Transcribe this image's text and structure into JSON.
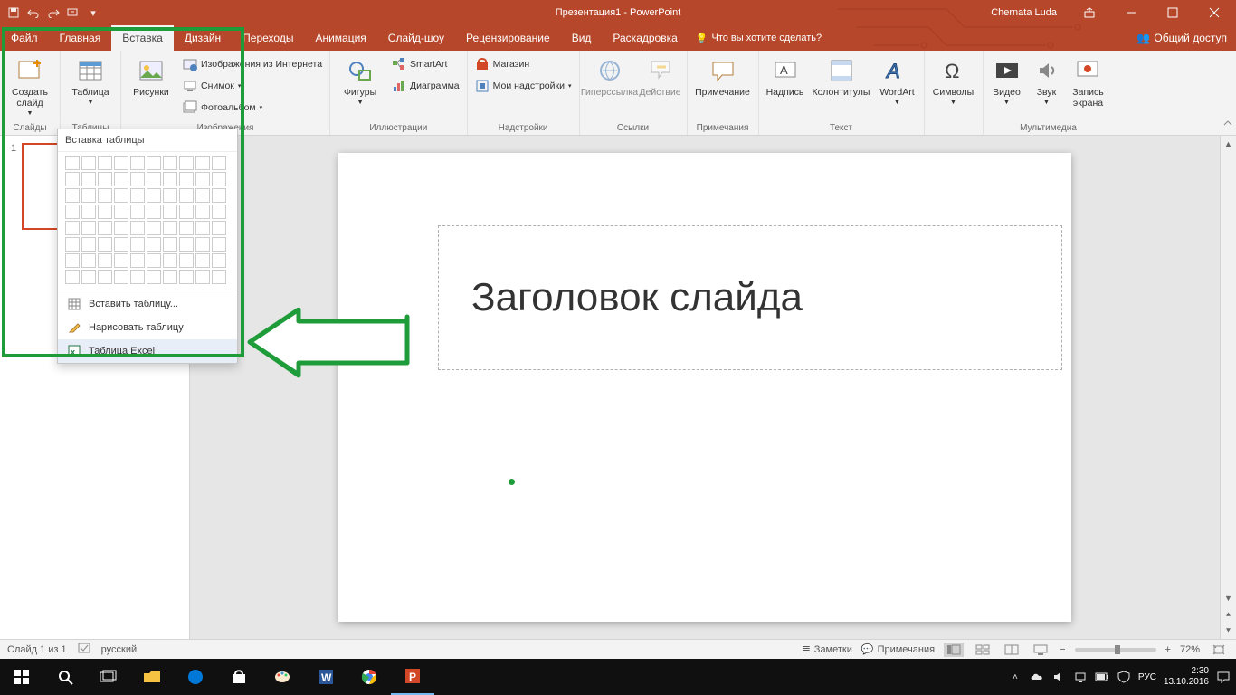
{
  "titlebar": {
    "app_title": "Презентация1 - PowerPoint",
    "user": "Chernata Luda",
    "qat_icons": [
      "save-icon",
      "undo-icon",
      "redo-icon",
      "start-from-beginning-icon"
    ]
  },
  "tabs": {
    "items": [
      "Файл",
      "Главная",
      "Вставка",
      "Дизайн",
      "Переходы",
      "Анимация",
      "Слайд-шоу",
      "Рецензирование",
      "Вид",
      "Раскадровка"
    ],
    "active": "Вставка",
    "tell_me": "Что вы хотите сделать?",
    "share": "Общий доступ"
  },
  "ribbon": {
    "slides": {
      "new_slide": "Создать слайд",
      "group": "Слайды"
    },
    "tables": {
      "table": "Таблица",
      "group": "Таблицы"
    },
    "images": {
      "pictures": "Рисунки",
      "online_pictures": "Изображения из Интернета",
      "screenshot": "Снимок",
      "photo_album": "Фотоальбом",
      "group": "Изображения"
    },
    "illustrations": {
      "shapes": "Фигуры",
      "smartart": "SmartArt",
      "chart": "Диаграмма",
      "group": "Иллюстрации"
    },
    "addins": {
      "store": "Магазин",
      "my_addins": "Мои надстройки",
      "group": "Надстройки"
    },
    "links": {
      "hyperlink": "Гиперссылка",
      "action": "Действие",
      "group": "Ссылки"
    },
    "comments": {
      "comment": "Примечание",
      "group": "Примечания"
    },
    "text": {
      "text_box": "Надпись",
      "header_footer": "Колонтитулы",
      "wordart": "WordArt",
      "group": "Текст"
    },
    "symbols": {
      "symbols": "Символы"
    },
    "media": {
      "video": "Видео",
      "audio": "Звук",
      "screen_rec": "Запись экрана",
      "group": "Мультимедиа"
    }
  },
  "table_dropdown": {
    "title": "Вставка таблицы",
    "insert_table": "Вставить таблицу...",
    "draw_table": "Нарисовать таблицу",
    "excel_table": "Таблица Excel"
  },
  "slide_titles": {
    "main_title": "Заголовок слайда"
  },
  "thumbs": {
    "num": "1"
  },
  "statusbar": {
    "slide_of": "Слайд 1 из 1",
    "language": "русский",
    "notes": "Заметки",
    "comments": "Примечания",
    "zoom": "72%"
  },
  "taskbar": {
    "lang": "РУС",
    "time": "2:30",
    "date": "13.10.2016"
  }
}
